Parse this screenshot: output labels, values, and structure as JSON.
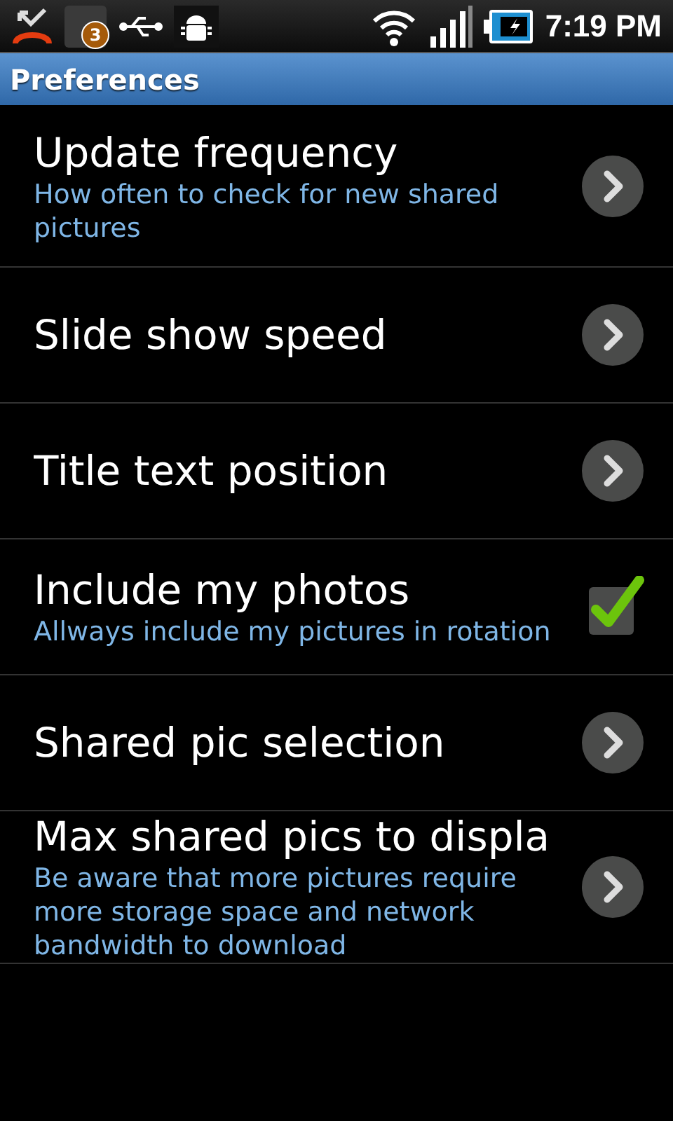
{
  "status_bar": {
    "notification_count": "3",
    "time": "7:19 PM"
  },
  "title_bar": {
    "title": "Preferences"
  },
  "preferences": [
    {
      "kind": "chevron",
      "title": "Update frequency",
      "summary": "How often to check for new shared pictures"
    },
    {
      "kind": "chevron",
      "title": "Slide show speed"
    },
    {
      "kind": "chevron",
      "title": "Title text position"
    },
    {
      "kind": "checkbox",
      "title": "Include my photos",
      "summary": "Allways include my pictures in rotation",
      "checked": true
    },
    {
      "kind": "chevron",
      "title": "Shared pic selection"
    },
    {
      "kind": "chevron",
      "title": "Max shared pics to displa",
      "summary": "Be aware that more pictures require more storage space and network bandwidth to download"
    }
  ]
}
